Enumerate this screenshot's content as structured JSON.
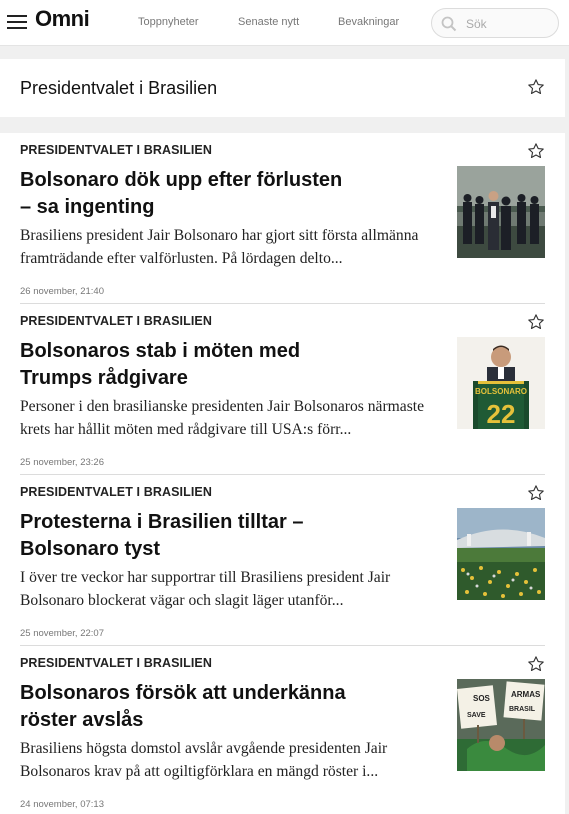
{
  "header": {
    "logo": "Omni",
    "nav": [
      "Toppnyheter",
      "Senaste nytt",
      "Bevakningar"
    ],
    "search_placeholder": "Sök"
  },
  "topic": {
    "title": "Presidentvalet i Brasilien"
  },
  "articles": [
    {
      "topic": "PRESIDENTVALET I BRASILIEN",
      "title": "Bolsonaro dök upp efter förlusten – sa ingenting",
      "lead": "Brasiliens president Jair Bolsonaro har gjort sitt första allmänna framträdande efter valförlusten. På lördagen delto...",
      "date": "26 november, 21:40"
    },
    {
      "topic": "PRESIDENTVALET I BRASILIEN",
      "title": "Bolsonaros stab i möten med Trumps rådgivare",
      "lead": "Personer i den brasilianske presidenten Jair Bolsonaros närmaste krets har hållit möten med rådgivare till USA:s förr...",
      "date": "25 november, 23:26",
      "image_text": [
        "BOLSONARO",
        "22"
      ]
    },
    {
      "topic": "PRESIDENTVALET I BRASILIEN",
      "title": "Protesterna i Brasilien tilltar – Bolsonaro tyst",
      "lead": "I över tre veckor har supportrar till Brasiliens president Jair Bolsonaro blockerat vägar och slagit läger utanför...",
      "date": "25 november, 22:07"
    },
    {
      "topic": "PRESIDENTVALET I BRASILIEN",
      "title": "Bolsonaros försök att underkänna röster avslås",
      "lead": "Brasiliens högsta domstol avslår avgående presidenten Jair Bolsonaros krav på att ogiltigförklara en mängd röster i...",
      "date": "24 november, 07:13",
      "image_text": [
        "SOS",
        "ARMAS",
        "SAVE",
        "BRASIL"
      ]
    }
  ],
  "colors": {
    "background": "#f0f0f0",
    "card": "#ffffff",
    "text": "#111111",
    "muted": "#777777",
    "divider": "#dcdcdc"
  }
}
